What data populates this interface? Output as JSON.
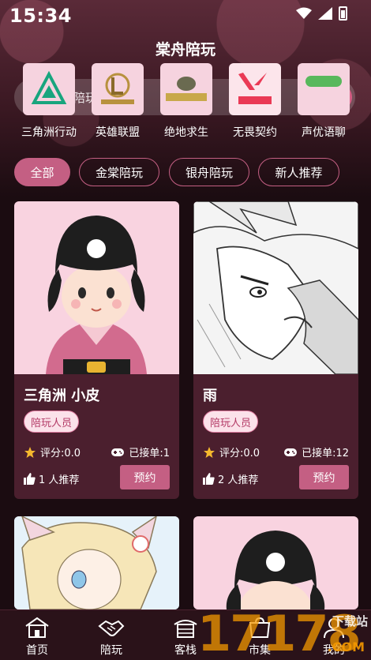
{
  "status_bar": {
    "time": "15:34"
  },
  "app_title": "棠舟陪玩",
  "search": {
    "placeholder": "陪玩关键词"
  },
  "games": [
    {
      "label": "三角洲行动",
      "icon_text": "三角洲行动",
      "bg": "#f9d6e2",
      "fg": "#1a9e7a"
    },
    {
      "label": "英雄联盟",
      "icon_text": "英雄联盟",
      "bg": "#f9d6e2",
      "fg": "#b08a3a"
    },
    {
      "label": "绝地求生",
      "icon_text": "BATTLEGROUNDS",
      "bg": "#f9d6e2",
      "fg": "#6b5a3a"
    },
    {
      "label": "无畏契约",
      "icon_text": "无畏契约",
      "bg": "#f9d6e2",
      "fg": "#e8394e"
    },
    {
      "label": "声优语聊",
      "icon_text": "",
      "bg": "#f9d6e2",
      "fg": "#4caf50"
    }
  ],
  "tabs": [
    "全部",
    "金棠陪玩",
    "银舟陪玩",
    "新人推荐"
  ],
  "active_tab": 0,
  "cards": [
    {
      "name": "三角洲 小皮",
      "role": "陪玩人员",
      "rating_label": "评分:0.0",
      "orders_label": "已接单:1",
      "recommend_label": "1 人推荐",
      "book_label": "预约",
      "img": "chibi"
    },
    {
      "name": "雨",
      "role": "陪玩人员",
      "rating_label": "评分:0.0",
      "orders_label": "已接单:12",
      "recommend_label": "2 人推荐",
      "book_label": "预约",
      "img": "manga"
    },
    {
      "img": "anime-girl"
    },
    {
      "img": "chibi"
    }
  ],
  "nav": [
    {
      "label": "首页",
      "icon": "home-icon"
    },
    {
      "label": "陪玩",
      "icon": "handshake-icon"
    },
    {
      "label": "客栈",
      "icon": "inn-icon"
    },
    {
      "label": "市集",
      "icon": "market-icon"
    },
    {
      "label": "我的",
      "icon": "profile-icon"
    }
  ],
  "watermark": {
    "main": "17178",
    "sub": "下载站",
    "domain": ".COM"
  },
  "colors": {
    "accent": "#c45f83",
    "card_bg": "#4b1f2e",
    "page_bg": "#1b0c11"
  }
}
